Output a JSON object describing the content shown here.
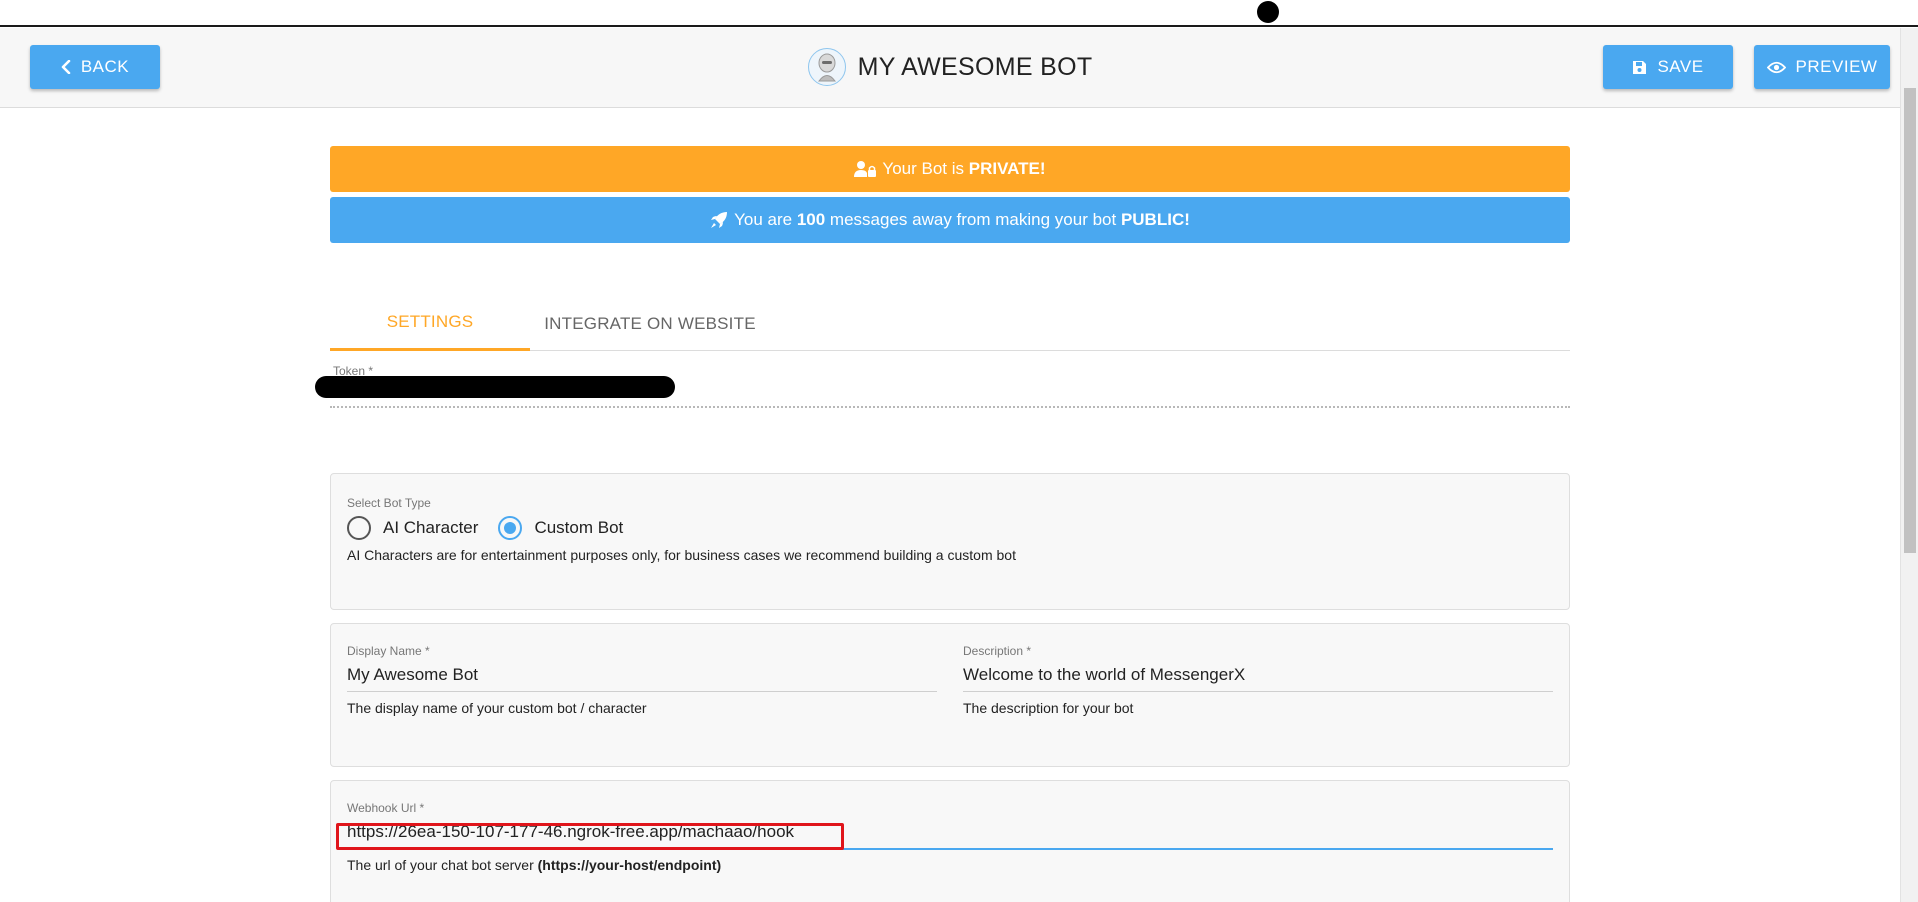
{
  "header": {
    "back_label": "BACK",
    "title": "MY AWESOME BOT",
    "save_label": "SAVE",
    "preview_label": "PREVIEW"
  },
  "banners": {
    "private_prefix": "Your Bot is ",
    "private_strong": "PRIVATE!",
    "public_prefix": "You are ",
    "public_count": "100",
    "public_middle": " messages away from making your bot ",
    "public_strong": "PUBLIC!"
  },
  "tabs": {
    "settings": "SETTINGS",
    "integrate": "INTEGRATE ON WEBSITE"
  },
  "token": {
    "label": "Token *"
  },
  "bot_type": {
    "label": "Select Bot Type",
    "options": [
      "AI Character",
      "Custom Bot"
    ],
    "selected": "Custom Bot",
    "helper": "AI Characters are for entertainment purposes only, for business cases we recommend building a custom bot"
  },
  "display_name": {
    "label": "Display Name *",
    "value": "My Awesome Bot",
    "helper": "The display name of your custom bot / character"
  },
  "description": {
    "label": "Description *",
    "value": "Welcome to the world of MessengerX",
    "helper": "The description for your bot"
  },
  "webhook": {
    "label": "Webhook Url *",
    "value": "https://26ea-150-107-177-46.ngrok-free.app/machaao/hook",
    "helper_prefix": "The url of your chat bot server ",
    "helper_strong": "(https://your-host/endpoint)"
  },
  "colors": {
    "primary": "#4aa8f0",
    "warning": "#ffa726",
    "highlight": "#e0151b"
  },
  "icons": [
    "chevron-left-icon",
    "robot-avatar-icon",
    "save-icon",
    "eye-icon",
    "user-lock-icon",
    "rocket-icon"
  ]
}
